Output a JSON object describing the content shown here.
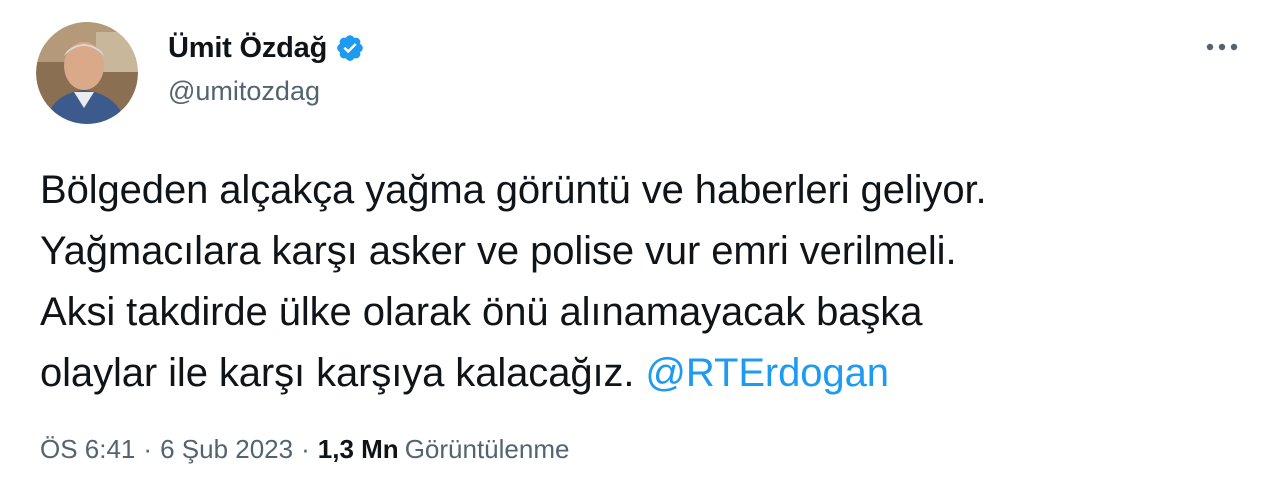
{
  "author": {
    "display_name": "Ümit Özdağ",
    "handle": "@umitozdag",
    "verified": true
  },
  "tweet": {
    "lines": [
      "Bölgeden alçakça yağma görüntü ve haberleri geliyor.",
      "Yağmacılara karşı asker ve polise vur emri verilmeli.",
      "Aksi takdirde ülke olarak önü alınamayacak başka",
      "olaylar ile karşı karşıya kalacağız. "
    ],
    "mention": "@RTErdogan"
  },
  "meta": {
    "time": "ÖS 6:41",
    "separator": "·",
    "date": "6 Şub 2023",
    "views_count": "1,3 Mn",
    "views_label": "Görüntülenme"
  },
  "colors": {
    "accent": "#1d9bf0",
    "text": "#0f1419",
    "secondary": "#536471"
  },
  "icons": {
    "verified": "verified-badge-icon",
    "more": "more-options-icon"
  }
}
